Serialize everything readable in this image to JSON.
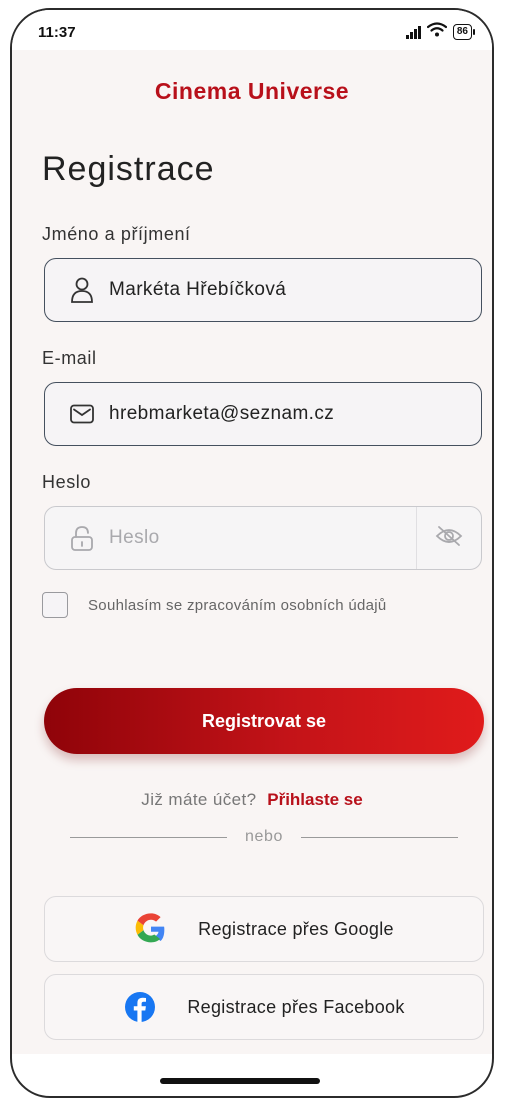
{
  "status": {
    "time": "11:37",
    "battery": "86"
  },
  "app": {
    "brand": "Cinema Universe"
  },
  "form": {
    "title": "Registrace",
    "name_label": "Jméno a příjmení",
    "name_value": "Markéta Hřebíčková",
    "email_label": "E-mail",
    "email_value": "hrebmarketa@seznam.cz",
    "password_label": "Heslo",
    "password_placeholder": "Heslo",
    "consent": "Souhlasím se zpracováním osobních údajů",
    "submit": "Registrovat se"
  },
  "login": {
    "question": "Již máte účet?",
    "link": "Přihlaste se"
  },
  "divider": "nebo",
  "social": {
    "google": "Registrace přes Google",
    "facebook": "Registrace přes Facebook"
  },
  "colors": {
    "brand": "#b8101a",
    "button_start": "#8f0309",
    "button_end": "#e01b1b"
  }
}
